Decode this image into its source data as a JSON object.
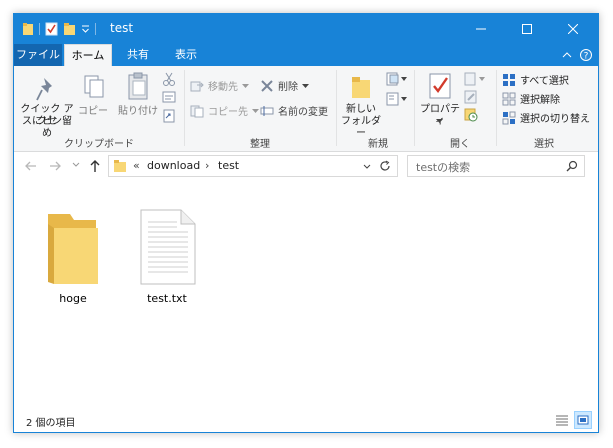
{
  "window": {
    "title": "test",
    "minimize_glyph": "—",
    "maximize_glyph": "☐",
    "close_glyph": "✕"
  },
  "tabs": [
    {
      "label": "ファイル"
    },
    {
      "label": "ホーム"
    },
    {
      "label": "共有"
    },
    {
      "label": "表示"
    }
  ],
  "ribbon": {
    "pin_label_1": "クイック アクセ",
    "pin_label_2": "スにピン留め",
    "copy_label": "コピー",
    "paste_label": "貼り付け",
    "clipboard_group": "クリップボード",
    "move_to": "移動先",
    "copy_to": "コピー先",
    "delete": "削除",
    "rename": "名前の変更",
    "organize_group": "整理",
    "new_folder_1": "新しい",
    "new_folder_2": "フォルダー",
    "new_group": "新規",
    "properties": "プロパティ",
    "open_group": "開く",
    "select_all": "すべて選択",
    "select_none": "選択解除",
    "invert_selection": "選択の切り替え",
    "select_group": "選択",
    "help_glyph": "?",
    "collapse_glyph": "^"
  },
  "address": {
    "prefix": "«",
    "crumb_1": "download",
    "crumb_2": "test",
    "separator": "›",
    "search_placeholder": "testの検索"
  },
  "items": [
    {
      "name": "hoge",
      "type": "folder"
    },
    {
      "name": "test.txt",
      "type": "text-file"
    }
  ],
  "status": {
    "count_text": "2 個の項目"
  },
  "colors": {
    "titlebar": "#1883d7",
    "file_tab": "#1366b0",
    "ribbon_bg": "#f5f6f7",
    "folder_yellow": "#f8d775"
  }
}
